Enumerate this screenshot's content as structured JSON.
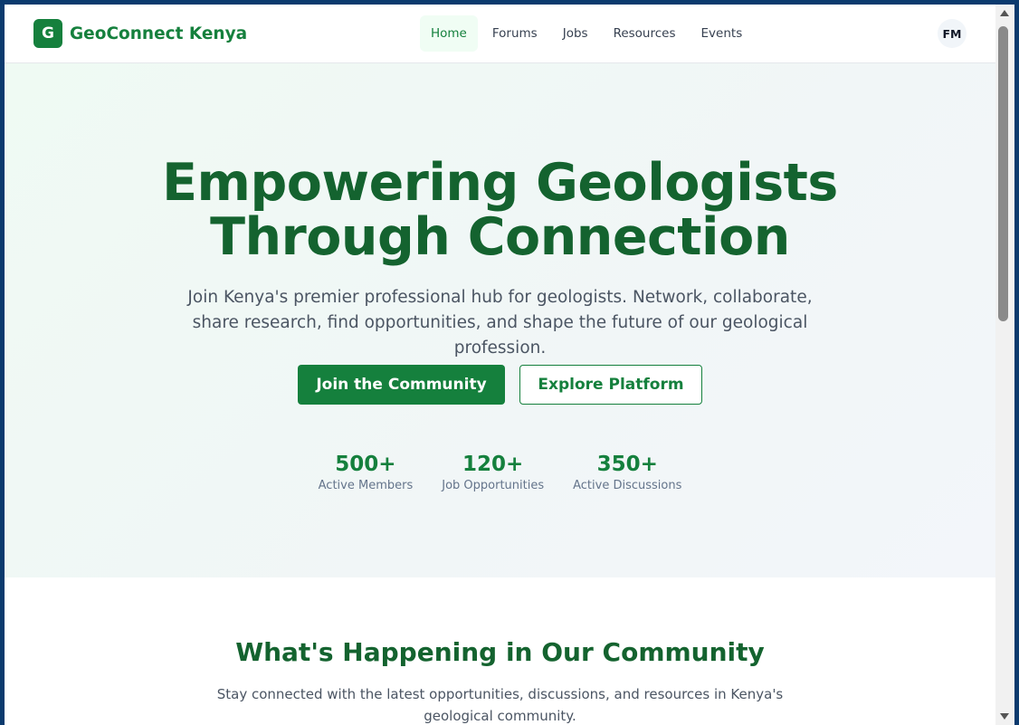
{
  "header": {
    "logo_letter": "G",
    "brand_name": "GeoConnect Kenya",
    "nav": [
      {
        "label": "Home",
        "active": true
      },
      {
        "label": "Forums",
        "active": false
      },
      {
        "label": "Jobs",
        "active": false
      },
      {
        "label": "Resources",
        "active": false
      },
      {
        "label": "Events",
        "active": false
      }
    ],
    "avatar_initials": "FM"
  },
  "hero": {
    "title_line1": "Empowering Geologists",
    "title_line2": "Through Connection",
    "subtitle": "Join Kenya's premier professional hub for geologists. Network, collaborate, share research, find opportunities, and shape the future of our geological profession.",
    "primary_button": "Join the Community",
    "secondary_button": "Explore Platform",
    "stats": [
      {
        "value": "500+",
        "label": "Active Members"
      },
      {
        "value": "120+",
        "label": "Job Opportunities"
      },
      {
        "value": "350+",
        "label": "Active Discussions"
      }
    ]
  },
  "community": {
    "title": "What's Happening in Our Community",
    "subtitle": "Stay connected with the latest opportunities, discussions, and resources in Kenya's geological community."
  },
  "colors": {
    "brand_green": "#15803d",
    "heading_green": "#14632f",
    "active_nav_bg": "#f0fdf4",
    "frame_blue": "#0b3a6e"
  },
  "icons": {
    "scroll_up": "triangle-up",
    "scroll_down": "triangle-down"
  }
}
